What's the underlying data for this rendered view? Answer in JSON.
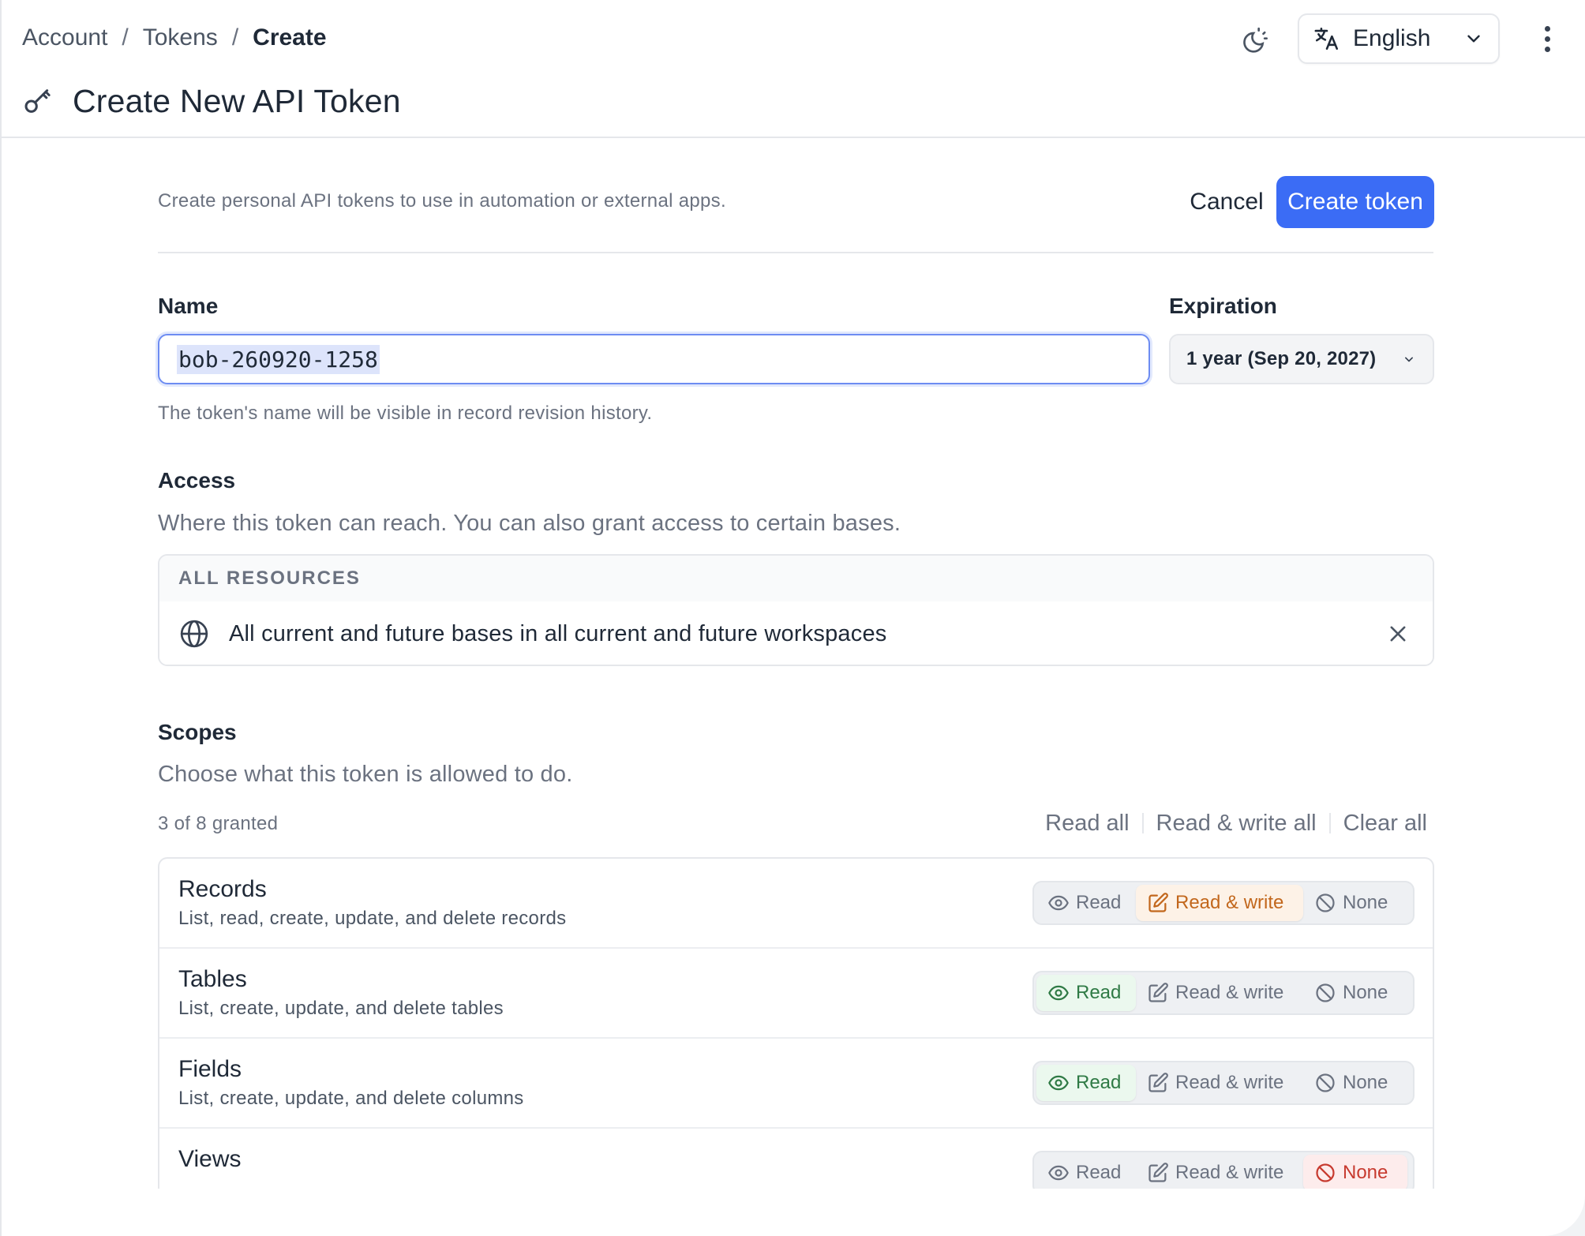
{
  "breadcrumb": {
    "items": [
      "Account",
      "Tokens"
    ],
    "separator": "/",
    "current": "Create"
  },
  "header": {
    "title": "Create New API Token",
    "language": "English",
    "icons": {
      "title": "key-icon",
      "theme": "theme-toggle-icon",
      "language": "translate-icon",
      "language_caret": "chevron-down-icon",
      "more": "more-vertical-icon"
    }
  },
  "intro": {
    "text": "Create personal API tokens to use in automation or external apps.",
    "cancel_label": "Cancel",
    "create_label": "Create token"
  },
  "name_field": {
    "label": "Name",
    "value": "bob-260920-1258",
    "hint": "The token's name will be visible in record revision history."
  },
  "expiration": {
    "label": "Expiration",
    "value": "1 year (Sep 20, 2027)"
  },
  "access": {
    "title": "Access",
    "description": "Where this token can reach. You can also grant access to certain bases.",
    "group_header": "ALL RESOURCES",
    "resource_text": "All current and future bases in all current and future workspaces"
  },
  "scopes": {
    "title": "Scopes",
    "description": "Choose what this token is allowed to do.",
    "granted_text": "3 of 8 granted",
    "bulk": {
      "read_all": "Read all",
      "read_write_all": "Read & write all",
      "clear_all": "Clear all"
    },
    "option_labels": {
      "read": "Read",
      "read_write": "Read & write",
      "none": "None"
    },
    "items": [
      {
        "name": "Records",
        "description": "List, read, create, update, and delete records",
        "selected": "read_write"
      },
      {
        "name": "Tables",
        "description": "List, create, update, and delete tables",
        "selected": "read"
      },
      {
        "name": "Fields",
        "description": "List, create, update, and delete columns",
        "selected": "read"
      },
      {
        "name": "Views",
        "description": "",
        "selected": "none"
      }
    ]
  },
  "colors": {
    "primary": "#3b6cf5",
    "read_active_bg": "#ebf8ee",
    "read_active_text": "#2f7a45",
    "rw_active_bg": "#fdf2e7",
    "rw_active_text": "#c2671c",
    "none_active_bg": "#fdecec",
    "none_active_text": "#c73a2f"
  }
}
